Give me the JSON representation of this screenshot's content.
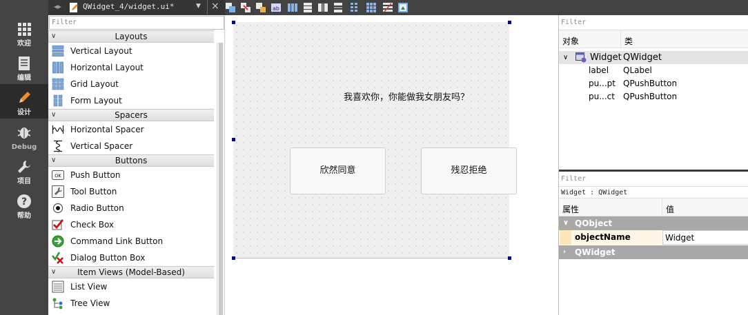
{
  "modebar": {
    "items": [
      {
        "label": "欢迎",
        "icon": "grid-icon"
      },
      {
        "label": "编辑",
        "icon": "document-icon"
      },
      {
        "label": "设计",
        "icon": "pencil-icon"
      },
      {
        "label": "Debug",
        "icon": "bug-icon"
      },
      {
        "label": "项目",
        "icon": "wrench-icon"
      },
      {
        "label": "帮助",
        "icon": "help-icon"
      }
    ],
    "active": "设计"
  },
  "topbar": {
    "file_name": "QWidget_4/widget.ui*",
    "icons": [
      "edit-widgets-icon",
      "edit-signals-icon",
      "edit-buddies-icon",
      "edit-tab-order-icon",
      "layout-horizontal-icon",
      "layout-vertical-icon",
      "layout-h-splitter-icon",
      "layout-v-splitter-icon",
      "layout-form-icon",
      "layout-grid-icon",
      "break-layout-icon",
      "adjust-size-icon"
    ]
  },
  "widgetbox": {
    "filter_placeholder": "Filter",
    "categories": [
      {
        "name": "Layouts",
        "items": [
          "Vertical Layout",
          "Horizontal Layout",
          "Grid Layout",
          "Form Layout"
        ]
      },
      {
        "name": "Spacers",
        "items": [
          "Horizontal Spacer",
          "Vertical Spacer"
        ]
      },
      {
        "name": "Buttons",
        "items": [
          "Push Button",
          "Tool Button",
          "Radio Button",
          "Check Box",
          "Command Link Button",
          "Dialog Button Box"
        ]
      },
      {
        "name": "Item Views (Model-Based)",
        "items": [
          "List View",
          "Tree View"
        ]
      }
    ]
  },
  "form": {
    "label_text": "我喜欢你，你能做我女朋友吗？",
    "button_accept": "欣然同意",
    "button_refuse": "残忍拒绝"
  },
  "object_inspector": {
    "filter_placeholder": "Filter",
    "col_object": "对象",
    "col_class": "类",
    "rows": [
      {
        "name": "Widget",
        "cls": "QWidget"
      },
      {
        "name": "label",
        "cls": "QLabel"
      },
      {
        "name": "pu...pt",
        "cls": "QPushButton"
      },
      {
        "name": "pu...ct",
        "cls": "QPushButton"
      }
    ]
  },
  "property_editor": {
    "filter_placeholder": "Filter",
    "class_line": "Widget : QWidget",
    "col_property": "属性",
    "col_value": "值",
    "groups": [
      "QObject",
      "QWidget"
    ],
    "prop_name": "objectName",
    "prop_value": "Widget"
  }
}
